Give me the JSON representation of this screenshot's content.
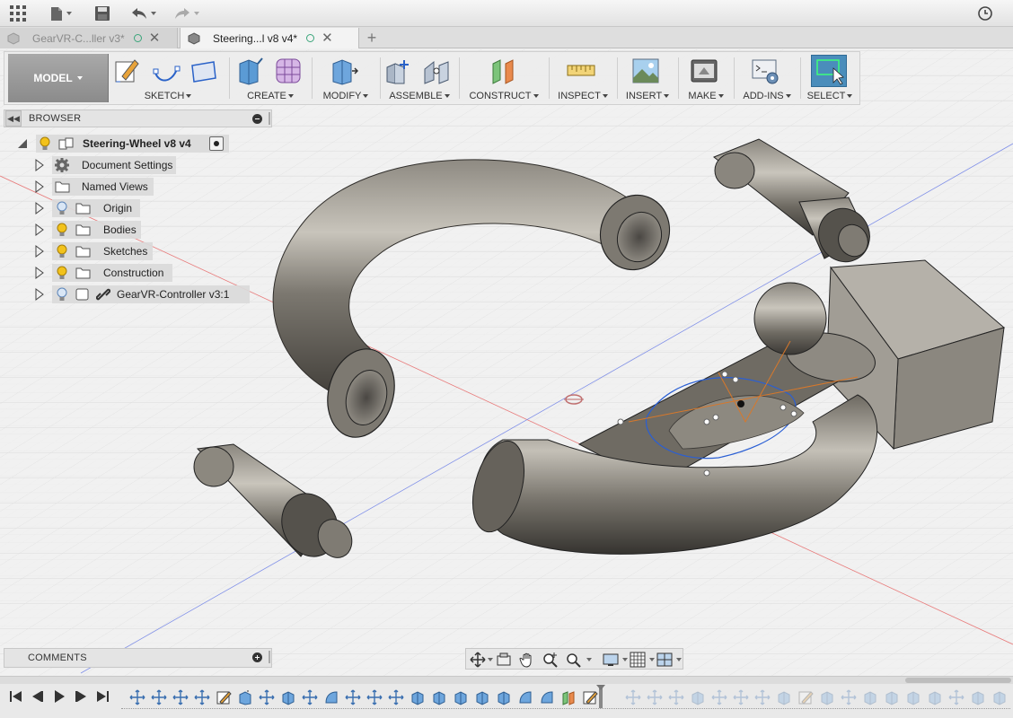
{
  "window": {
    "tabs": [
      {
        "label": "GearVR-C...ller v3*",
        "active": false
      },
      {
        "label": "Steering...l v8 v4*",
        "active": true
      }
    ]
  },
  "ribbon": {
    "workspace": "MODEL",
    "groups": [
      {
        "label": "SKETCH"
      },
      {
        "label": "CREATE"
      },
      {
        "label": "MODIFY"
      },
      {
        "label": "ASSEMBLE"
      },
      {
        "label": "CONSTRUCT"
      },
      {
        "label": "INSPECT"
      },
      {
        "label": "INSERT"
      },
      {
        "label": "MAKE"
      },
      {
        "label": "ADD-INS"
      },
      {
        "label": "SELECT"
      }
    ]
  },
  "browser": {
    "title": "BROWSER",
    "root": "Steering-Wheel v8 v4",
    "items": [
      {
        "label": "Document Settings",
        "icon": "gear-icon"
      },
      {
        "label": "Named Views",
        "icon": "folder-icon"
      },
      {
        "label": "Origin",
        "icon": "folder-icon",
        "bulb": "off"
      },
      {
        "label": "Bodies",
        "icon": "folder-icon",
        "bulb": "on"
      },
      {
        "label": "Sketches",
        "icon": "folder-icon",
        "bulb": "on"
      },
      {
        "label": "Construction",
        "icon": "folder-icon",
        "bulb": "on"
      },
      {
        "label": "GearVR-Controller v3:1",
        "icon": "component-link-icon",
        "bulb": "off"
      }
    ]
  },
  "comments": {
    "title": "COMMENTS"
  },
  "colors": {
    "accent_blue": "#3b7fc0",
    "select_active": "#4a8dbb",
    "bulb_on": "#f2c21b",
    "model_metal": "#6e6a62",
    "sketch_orange": "#d8782a",
    "tab_indicator": "#3aa57a"
  }
}
